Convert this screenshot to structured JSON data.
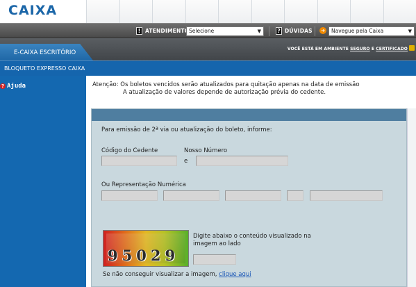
{
  "header": {
    "logo_text": "CAIXA"
  },
  "toolbar": {
    "atendimento_label": "ATENDIMENTO",
    "atendimento_selected": "Selecione",
    "duvidas_label": "DÚVIDAS",
    "navegue_selected": "Navegue pela Caixa"
  },
  "strip": {
    "secure_prefix": "VOCÊ ESTÁ EM AMBIENTE",
    "secure_word": "SEGURO",
    "secure_conj": "E",
    "cert_word": "CERTIFICADO"
  },
  "nav": {
    "ecaixa_tab": "E-CAIXA ESCRITÓRIO",
    "section_label": "BLOQUETO EXPRESSO CAIXA"
  },
  "sidebar": {
    "help_label": "Ajuda"
  },
  "notice": {
    "line1": "Atenção: Os boletos vencidos serão atualizados para quitação apenas na data de emissão",
    "line2": "A atualização de valores depende de autorização prévia do cedente."
  },
  "form": {
    "intro": "Para emissão de 2ª via ou atualização do boleto, informe:",
    "codigo_cedente_label": "Código do Cedente",
    "nosso_numero_label": "Nosso Número",
    "and_label": "e",
    "representacao_label": "Ou Representação Numérica",
    "captcha_value": "95029",
    "captcha_instruction_1": "Digite abaixo o conteúdo visualizado na",
    "captcha_instruction_2": "imagem ao lado",
    "cannot_view_text": "Se não conseguir visualizar a imagem,",
    "click_here_link": "clique aqui"
  },
  "colors": {
    "brand_blue": "#1468b0",
    "brand_orange": "#f08a00",
    "panel_bg": "#c9d8de"
  }
}
